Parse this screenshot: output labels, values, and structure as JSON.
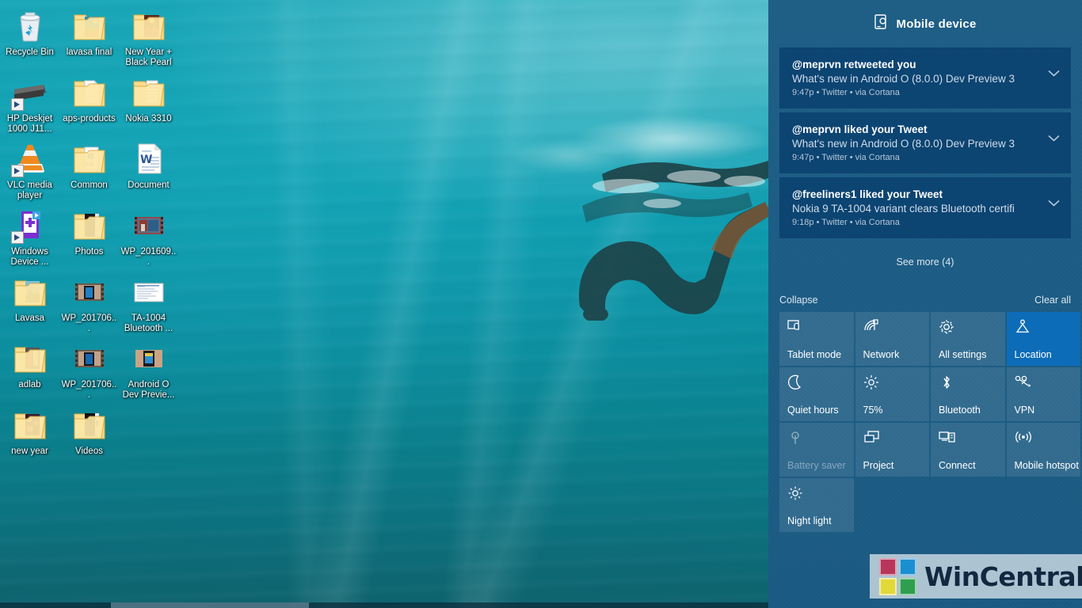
{
  "desktop": {
    "wallpaper_description": "underwater teal ocean with snorkeling diver silhouette",
    "accent_color": "#0078d7",
    "panel_bg": "#1b5c85",
    "card_bg": "#0c4472",
    "icons": [
      {
        "label": "Recycle Bin",
        "type": "recycle-bin",
        "shortcut": false
      },
      {
        "label": "lavasa final",
        "type": "folder-photos",
        "shortcut": false
      },
      {
        "label": "New Year + Black Pearl",
        "type": "folder-photos",
        "shortcut": false
      },
      {
        "label": "HP Deskjet 1000 J11...",
        "type": "printer",
        "shortcut": true
      },
      {
        "label": "aps-products",
        "type": "folder-doc",
        "shortcut": false
      },
      {
        "label": "Nokia 3310",
        "type": "folder-doc",
        "shortcut": false
      },
      {
        "label": "VLC media player",
        "type": "vlc-cone",
        "shortcut": true
      },
      {
        "label": "Common",
        "type": "folder-browser",
        "shortcut": false
      },
      {
        "label": "Document",
        "type": "word-document",
        "shortcut": false
      },
      {
        "label": "Windows Device ...",
        "type": "windows-device-recovery",
        "shortcut": true
      },
      {
        "label": "Photos",
        "type": "folder-dark",
        "shortcut": false
      },
      {
        "label": "WP_201609...",
        "type": "video-thumb",
        "shortcut": false
      },
      {
        "label": "Lavasa",
        "type": "folder-photos",
        "shortcut": false
      },
      {
        "label": "WP_201706...",
        "type": "video-thumb",
        "shortcut": false
      },
      {
        "label": "TA-1004 Bluetooth ...",
        "type": "web-page",
        "shortcut": false
      },
      {
        "label": "adlab",
        "type": "folder-photos",
        "shortcut": false
      },
      {
        "label": "WP_201706...",
        "type": "video-thumb",
        "shortcut": false
      },
      {
        "label": "Android O Dev Previe...",
        "type": "image-thumb",
        "shortcut": false
      },
      {
        "label": "new year",
        "type": "folder-photos",
        "shortcut": false
      },
      {
        "label": "Videos",
        "type": "folder-dark",
        "shortcut": false
      }
    ]
  },
  "action_center": {
    "header": {
      "icon": "mobile-device-icon",
      "title": "Mobile device"
    },
    "notifications": [
      {
        "title": "@meprvn retweeted you",
        "body": "What's new in Android O (8.0.0) Dev Preview 3",
        "meta": "9:47p • Twitter • via Cortana",
        "expand_icon": "chevron-down-icon"
      },
      {
        "title": "@meprvn liked your Tweet",
        "body": "What's new in Android O (8.0.0) Dev Preview 3",
        "meta": "9:47p • Twitter • via Cortana",
        "expand_icon": "chevron-down-icon"
      },
      {
        "title": "@freeliners1 liked your Tweet",
        "body": "Nokia 9 TA-1004 variant clears Bluetooth certifi",
        "meta": "9:18p • Twitter • via Cortana",
        "expand_icon": "chevron-down-icon"
      }
    ],
    "see_more_label": "See more (4)",
    "collapse_label": "Collapse",
    "clear_all_label": "Clear all",
    "quick_actions": [
      {
        "label": "Tablet mode",
        "icon": "tablet-mode-icon",
        "state": "normal"
      },
      {
        "label": "Network",
        "icon": "network-icon",
        "state": "normal"
      },
      {
        "label": "All settings",
        "icon": "gear-icon",
        "state": "normal"
      },
      {
        "label": "Location",
        "icon": "location-icon",
        "state": "active"
      },
      {
        "label": "Quiet hours",
        "icon": "moon-icon",
        "state": "normal"
      },
      {
        "label": "75%",
        "icon": "brightness-icon",
        "state": "normal"
      },
      {
        "label": "Bluetooth",
        "icon": "bluetooth-icon",
        "state": "normal"
      },
      {
        "label": "VPN",
        "icon": "vpn-icon",
        "state": "normal"
      },
      {
        "label": "Battery saver",
        "icon": "battery-saver-icon",
        "state": "disabled"
      },
      {
        "label": "Project",
        "icon": "project-icon",
        "state": "normal"
      },
      {
        "label": "Connect",
        "icon": "connect-icon",
        "state": "normal"
      },
      {
        "label": "Mobile hotspot",
        "icon": "mobile-hotspot-icon",
        "state": "normal"
      },
      {
        "label": "Night light",
        "icon": "night-light-icon",
        "state": "normal"
      }
    ]
  },
  "watermark": {
    "text": "WinCentral",
    "logo_colors": [
      "#b8365a",
      "#1a8fd0",
      "#e2d83a",
      "#2f9e4f"
    ]
  }
}
